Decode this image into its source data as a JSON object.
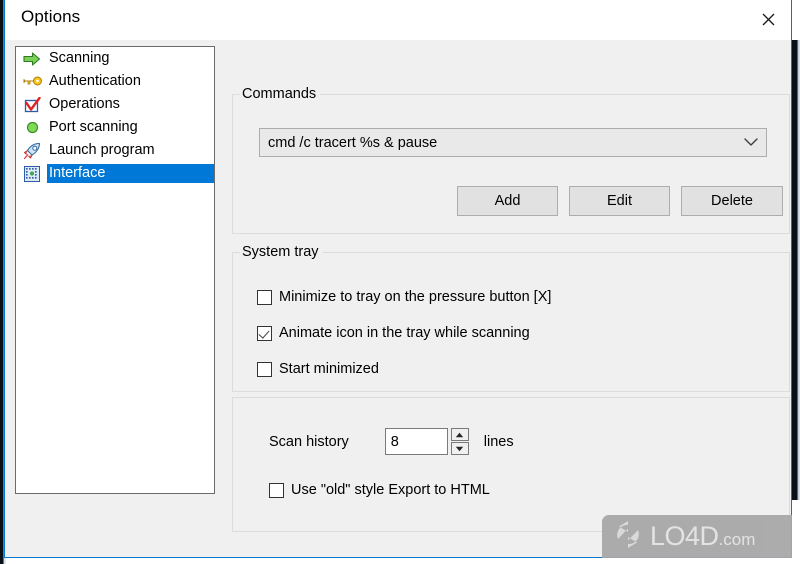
{
  "window": {
    "title": "Options",
    "close_label": "Close",
    "accent_color": "#0078d7",
    "background_color": "#f0f0f0"
  },
  "categories": [
    {
      "label": "Scanning",
      "icon": "green-arrow-icon",
      "selected": false
    },
    {
      "label": "Authentication",
      "icon": "key-icon",
      "selected": false
    },
    {
      "label": "Operations",
      "icon": "red-checkmark-icon",
      "selected": false
    },
    {
      "label": "Port scanning",
      "icon": "green-circle-icon",
      "selected": false
    },
    {
      "label": "Launch program",
      "icon": "rocket-icon",
      "selected": false
    },
    {
      "label": "Interface",
      "icon": "interface-grid-icon",
      "selected": true
    }
  ],
  "commands": {
    "legend": "Commands",
    "selected_command": "cmd /c tracert %s & pause",
    "dropdown_icon": "chevron-down-icon",
    "buttons": {
      "add": "Add",
      "edit": "Edit",
      "delete": "Delete"
    }
  },
  "system_tray": {
    "legend": "System tray",
    "options": [
      {
        "label": "Minimize to tray on the pressure button [X]",
        "checked": false
      },
      {
        "label": "Animate icon in the tray while scanning",
        "checked": true
      },
      {
        "label": "Start minimized",
        "checked": false
      }
    ]
  },
  "history": {
    "label": "Scan history",
    "value": "8",
    "units": "lines",
    "spinner_up_icon": "spin-up-icon",
    "spinner_down_icon": "spin-down-icon",
    "export_option": {
      "label": "Use \"old\" style Export to HTML",
      "checked": false
    }
  },
  "watermark": {
    "name": "LO4D",
    "tld": ".com",
    "icon": "refresh-arrows-icon"
  }
}
